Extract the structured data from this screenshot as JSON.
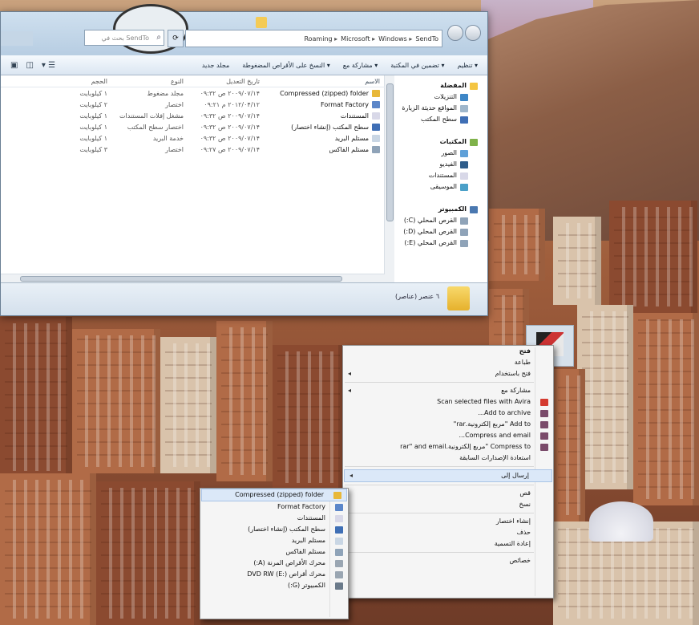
{
  "explorer": {
    "address_path": [
      "SendTo",
      "Windows",
      "Microsoft",
      "Roaming"
    ],
    "search_placeholder": "بحث في SendTo",
    "toolbar": {
      "organize": "تنظيم",
      "include_in_library": "تضمين في المكتبة",
      "share_with": "مشاركة مع",
      "burn": "النسخ على الأقراص المضغوطة",
      "new_folder": "مجلد جديد"
    },
    "columns": {
      "name": "الاسم",
      "date": "تاريخ التعديل",
      "type": "النوع",
      "size": "الحجم"
    },
    "files": [
      {
        "name": "Compressed (zipped) folder",
        "date": "۲۰۰۹/۰۷/۱۴ ص ۰۹:۳۲",
        "type": "مجلد مضغوط",
        "size": "۱ كيلوبايت",
        "color": "#e8b83a"
      },
      {
        "name": "Format Factory",
        "date": "۲۰۱۲/۰۴/۱۲ م ۰۹:۲۱",
        "type": "اختصار",
        "size": "۲ كيلوبايت",
        "color": "#5b86c9"
      },
      {
        "name": "المستندات",
        "date": "۲۰۰۹/۰۷/۱۴ ص ۰۹:۳۲",
        "type": "مشغل إفلات المستندات",
        "size": "۱ كيلوبايت",
        "color": "#d8d8e8"
      },
      {
        "name": "سطح المكتب (إنشاء اختصار)",
        "date": "۲۰۰۹/۰۷/۱۴ ص ۰۹:۳۲",
        "type": "اختصار سطح المكتب",
        "size": "۱ كيلوبايت",
        "color": "#3f6fb5"
      },
      {
        "name": "مستلم البريد",
        "date": "۲۰۰۹/۰۷/۱۴ ص ۰۹:۳۲",
        "type": "خدمة البريد",
        "size": "۱ كيلوبايت",
        "color": "#c9d6e4"
      },
      {
        "name": "مستلم الفاكس",
        "date": "۲۰۰۹/۰۷/۱۴ ص ۰۹:۲۷",
        "type": "اختصار",
        "size": "۳ كيلوبايت",
        "color": "#8fa3b8"
      }
    ],
    "nav": {
      "favorites": {
        "label": "المفضلة",
        "items": [
          "التنزيلات",
          "المواقع حديثة الزيارة",
          "سطح المكتب"
        ]
      },
      "libraries": {
        "label": "المكتبات",
        "items": [
          "الصور",
          "الفيديو",
          "المستندات",
          "الموسيقى"
        ]
      },
      "computer": {
        "label": "الكمبيوتر",
        "items": [
          "القرص المحلي (C:)",
          "القرص المحلي (D:)",
          "القرص المحلي (E:)"
        ]
      }
    },
    "details": "٦ عنصر (عناصر)"
  },
  "context_menu": {
    "items": [
      {
        "label": "فتح",
        "bold": true
      },
      {
        "label": "طباعة"
      },
      {
        "label": "فتح باستخدام",
        "sub": true
      },
      {
        "sep": true
      },
      {
        "label": "مشاركة مع",
        "sub": true
      },
      {
        "label": "Scan selected files with Avira",
        "icon": "#d43a2f"
      },
      {
        "label": "Add to archive...",
        "icon": "#7a4a6a"
      },
      {
        "label": "Add to \"مربع إلكترونية.rar\"",
        "icon": "#7a4a6a"
      },
      {
        "label": "Compress and email...",
        "icon": "#7a4a6a"
      },
      {
        "label": "Compress to \"مربع إلكترونية.rar\" and email",
        "icon": "#7a4a6a"
      },
      {
        "label": "استعادة الإصدارات السابقة"
      },
      {
        "sep": true
      },
      {
        "label": "إرسال إلى",
        "sub": true,
        "hl": true
      },
      {
        "sep": true
      },
      {
        "label": "قص"
      },
      {
        "label": "نسخ"
      },
      {
        "sep": true
      },
      {
        "label": "إنشاء اختصار"
      },
      {
        "label": "حذف"
      },
      {
        "label": "إعادة التسمية"
      },
      {
        "sep": true
      },
      {
        "label": "خصائص"
      }
    ]
  },
  "sendto_menu": {
    "items": [
      {
        "label": "Compressed (zipped) folder",
        "icon": "#e8b83a",
        "hl": true
      },
      {
        "label": "Format Factory",
        "icon": "#5b86c9"
      },
      {
        "label": "المستندات",
        "icon": "#d8d8e8"
      },
      {
        "label": "سطح المكتب (إنشاء اختصار)",
        "icon": "#3f6fb5"
      },
      {
        "label": "مستلم البريد",
        "icon": "#c9d6e4"
      },
      {
        "label": "مستلم الفاكس",
        "icon": "#8fa3b8"
      },
      {
        "label": "محرك الأقراص المرنة (A:)",
        "icon": "#9aa6b2"
      },
      {
        "label": "محرك أقراص DVD RW (E:)",
        "icon": "#9aa6b2"
      },
      {
        "label": "الكمبيوتر (G:)",
        "icon": "#6b7a8a"
      }
    ]
  }
}
